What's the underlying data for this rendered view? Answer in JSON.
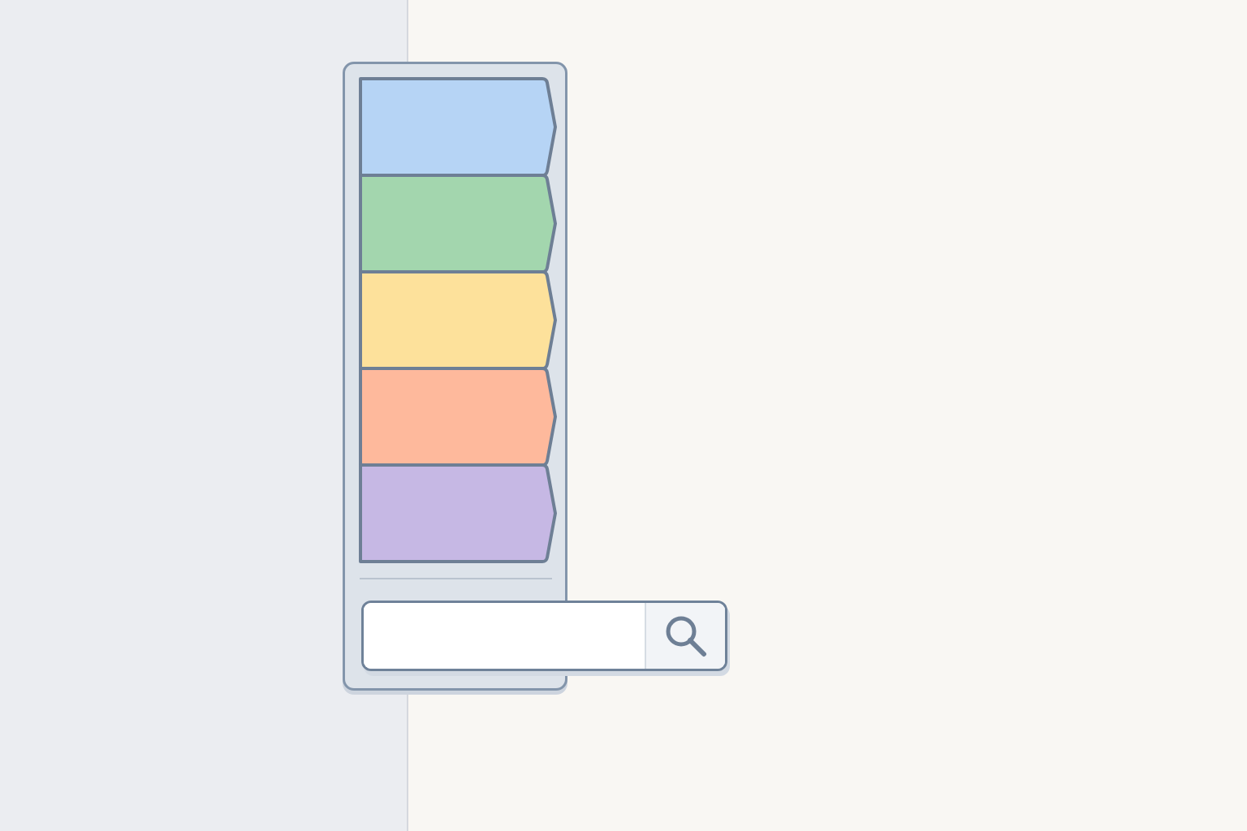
{
  "panel": {
    "tabs": [
      {
        "color": "#b6d4f5"
      },
      {
        "color": "#a3d6ae"
      },
      {
        "color": "#fde19b"
      },
      {
        "color": "#feb99c"
      },
      {
        "color": "#c6b8e4"
      }
    ]
  },
  "search": {
    "kind": "field_with_button"
  }
}
